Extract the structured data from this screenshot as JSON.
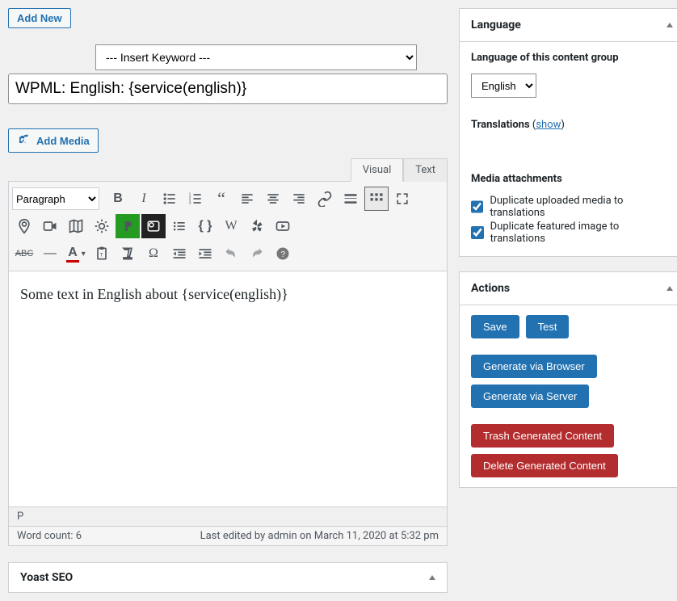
{
  "header": {
    "add_new": "Add New"
  },
  "editor": {
    "keyword_placeholder": "--- Insert Keyword ---",
    "title": "WPML: English: {service(english)}",
    "add_media": "Add Media",
    "visual_tab": "Visual",
    "text_tab": "Text",
    "format_selector": "Paragraph",
    "content": "Some text in English about {service(english)}",
    "status_path": "P",
    "word_count_label": "Word count: 6",
    "last_edited": "Last edited by admin on March 11, 2020 at 5:32 pm"
  },
  "language_box": {
    "title": "Language",
    "content_group_label": "Language of this content group",
    "selected_language": "English",
    "translations_label": "Translations",
    "show_label": "show",
    "media_attachments_label": "Media attachments",
    "chk_duplicate_media": "Duplicate uploaded media to translations",
    "chk_duplicate_featured": "Duplicate featured image to translations"
  },
  "actions_box": {
    "title": "Actions",
    "save": "Save",
    "test": "Test",
    "gen_browser": "Generate via Browser",
    "gen_server": "Generate via Server",
    "trash": "Trash Generated Content",
    "delete": "Delete Generated Content"
  },
  "yoast": {
    "title": "Yoast SEO"
  }
}
